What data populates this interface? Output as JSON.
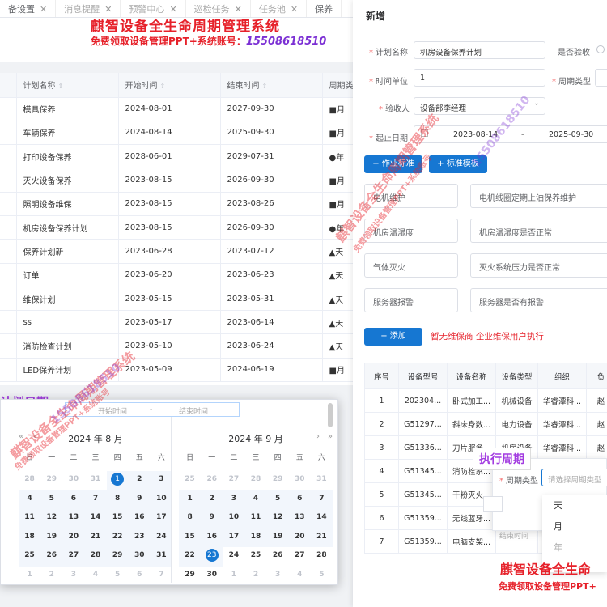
{
  "tabs": [
    {
      "label": "备设置",
      "closable": true
    },
    {
      "label": "消息提醒",
      "closable": true
    },
    {
      "label": "预警中心",
      "closable": true
    },
    {
      "label": "巡检任务",
      "closable": true
    },
    {
      "label": "任务池",
      "closable": true
    },
    {
      "label": "保养",
      "closable": false
    }
  ],
  "banner": {
    "title": "麒智设备全生命周期管理系统",
    "subtitle": "免费领取设备管理PPT+系统账号：",
    "phone": "15508618510"
  },
  "plan_table": {
    "columns": [
      "计划名称",
      "开始时间",
      "结束时间",
      "周期类"
    ],
    "rows": [
      [
        "模具保养",
        "2024-08-01",
        "2027-09-30",
        "■月"
      ],
      [
        "车辆保养",
        "2024-08-14",
        "2025-09-30",
        "■月"
      ],
      [
        "打印设备保养",
        "2028-06-01",
        "2029-07-31",
        "●年"
      ],
      [
        "灭火设备保养",
        "2023-08-15",
        "2026-09-30",
        "■月"
      ],
      [
        "照明设备维保",
        "2023-08-15",
        "2023-08-26",
        "■月"
      ],
      [
        "机房设备保养计划",
        "2023-08-15",
        "2026-09-30",
        "●年"
      ],
      [
        "保养计划新",
        "2023-06-28",
        "2023-07-12",
        "▲天"
      ],
      [
        "订单",
        "2023-06-20",
        "2023-06-23",
        "▲天"
      ],
      [
        "维保计划",
        "2023-05-15",
        "2023-05-31",
        "▲天"
      ],
      [
        "ss",
        "2023-05-17",
        "2023-06-14",
        "▲天"
      ],
      [
        "消防检查计划",
        "2023-05-10",
        "2023-06-24",
        "▲天"
      ],
      [
        "LED保养计划",
        "2023-05-09",
        "2024-06-19",
        "■月"
      ]
    ]
  },
  "date_picker": {
    "start_placeholder": "开始时间",
    "separator": "-",
    "end_placeholder": "结束时间",
    "weekdays": [
      "日",
      "一",
      "二",
      "三",
      "四",
      "五",
      "六"
    ],
    "left": {
      "title": "2024 年 8 月",
      "prev_year": "«",
      "prev_month": "‹",
      "weeks": [
        [
          "28",
          "29",
          "30",
          "31",
          "1",
          "2",
          "3"
        ],
        [
          "4",
          "5",
          "6",
          "7",
          "8",
          "9",
          "10"
        ],
        [
          "11",
          "12",
          "13",
          "14",
          "15",
          "16",
          "17"
        ],
        [
          "18",
          "19",
          "20",
          "21",
          "22",
          "23",
          "24"
        ],
        [
          "25",
          "26",
          "27",
          "28",
          "29",
          "30",
          "31"
        ],
        [
          "1",
          "2",
          "3",
          "4",
          "5",
          "6",
          "7"
        ]
      ]
    },
    "right": {
      "title": "2024 年 9 月",
      "next_month": "›",
      "next_year": "»",
      "weeks": [
        [
          "25",
          "26",
          "27",
          "28",
          "29",
          "30",
          "31"
        ],
        [
          "1",
          "2",
          "3",
          "4",
          "5",
          "6",
          "7"
        ],
        [
          "8",
          "9",
          "10",
          "11",
          "12",
          "13",
          "14"
        ],
        [
          "15",
          "16",
          "17",
          "18",
          "19",
          "20",
          "21"
        ],
        [
          "22",
          "23",
          "24",
          "25",
          "26",
          "27",
          "28"
        ],
        [
          "29",
          "30",
          "1",
          "2",
          "3",
          "4",
          "5"
        ]
      ]
    }
  },
  "annotation_plan_date": "计划日期",
  "annotation_exec_cycle": "执行周期",
  "drawer": {
    "title": "新增",
    "fields": {
      "plan_name_label": "计划名称",
      "plan_name_value": "机房设备保养计划",
      "need_accept_label": "是否验收",
      "time_unit_label": "时间单位",
      "time_unit_value": "1",
      "cycle_type_label": "周期类型",
      "acceptor_label": "验收人",
      "acceptor_value": "设备部李经理",
      "date_range_label": "起止日期",
      "date_start": "2023-08-14",
      "date_sep": "-",
      "date_end": "2025-09-30"
    },
    "buttons": {
      "work_standard": "+ 作业标准",
      "std_template": "+ 标准模板",
      "add": "+ 添加"
    },
    "standards": [
      [
        "电机维护",
        "电机线圈定期上油保养维护"
      ],
      [
        "机房温湿度",
        "机房温湿度是否正常"
      ],
      [
        "气体灭火",
        "灭火系统压力是否正常"
      ],
      [
        "服务器报警",
        "服务器是否有报警"
      ]
    ],
    "hint": "暂无维保商 企业维保用户执行",
    "equipment_table": {
      "columns": [
        "序号",
        "设备型号",
        "设备名称",
        "设备类型",
        "组织",
        "负"
      ],
      "rows": [
        [
          "1",
          "202304...",
          "卧式加工...",
          "机械设备",
          "华睿潭科...",
          "赵"
        ],
        [
          "2",
          "G51297...",
          "斜床身数...",
          "电力设备",
          "华睿潭科...",
          "赵"
        ],
        [
          "3",
          "G51336...",
          "刀片服务...",
          "机房设备",
          "华睿潭科...",
          "赵"
        ],
        [
          "4",
          "G51345...",
          "消防栓系...",
          "",
          "",
          ""
        ],
        [
          "5",
          "G51345...",
          "干粉灭火...",
          "",
          "",
          ""
        ],
        [
          "6",
          "G51359...",
          "无线蓝牙...",
          "",
          "",
          ""
        ],
        [
          "7",
          "G51359...",
          "电脑支架...",
          "",
          "",
          ""
        ]
      ]
    }
  },
  "cycle_popover": {
    "label": "周期类型",
    "placeholder": "请选择周期类型",
    "options": [
      "天",
      "月",
      "年"
    ],
    "end_time_label": "结束时间"
  },
  "bottom_banner": {
    "title": "麒智设备全生命",
    "subtitle": "免费领取设备管理PPT+"
  },
  "watermark": {
    "title": "麒智设备全生命周期管理系统",
    "subtitle": "免费领取设备管理PPT+系统账号",
    "phone": "15508618510"
  }
}
